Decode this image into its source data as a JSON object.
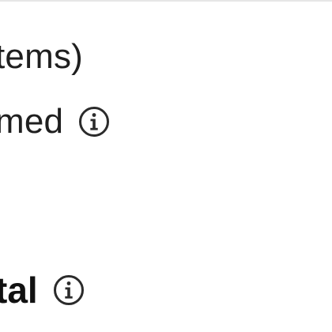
{
  "summary": {
    "items_label_fragment": "tems)",
    "reimbursed_label_fragment": "med",
    "total_label_fragment": "tal"
  },
  "icons": {
    "reimbursed_info": "info-circle-icon",
    "total_info": "info-circle-icon"
  },
  "colors": {
    "text": "#1f1f1f",
    "icon": "#2b2b2b",
    "divider": "#e6e6e6"
  }
}
